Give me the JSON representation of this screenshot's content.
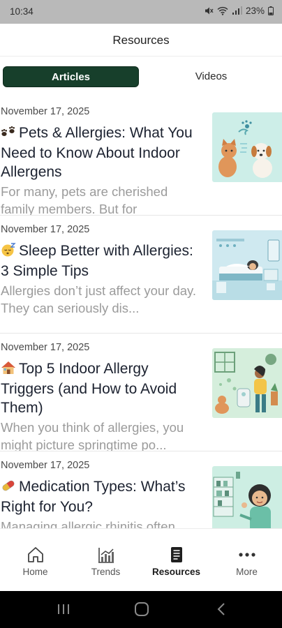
{
  "status_bar": {
    "time": "10:34",
    "battery": "23%"
  },
  "header": {
    "title": "Resources"
  },
  "tabs": {
    "articles": "Articles",
    "videos": "Videos"
  },
  "articles": [
    {
      "date": "November 17, 2025",
      "title": "Pets & Allergies: What You Need to Know About Indoor Allergens",
      "excerpt": "For many, pets are cherished family members. But for",
      "emoji": "paw-prints-icon",
      "thumbnail": "pets-illustration"
    },
    {
      "date": "November 17, 2025",
      "title": "Sleep Better with Allergies: 3 Simple Tips",
      "excerpt": "Allergies don’t just affect your day. They can seriously dis...",
      "emoji": "sleeping-face-icon",
      "thumbnail": "bedroom-illustration"
    },
    {
      "date": "November 17, 2025",
      "title": "Top 5 Indoor Allergy Triggers (and How to Avoid Them)",
      "excerpt": "When you think of allergies, you might picture springtime po...",
      "emoji": "house-icon",
      "thumbnail": "indoor-woman-illustration"
    },
    {
      "date": "November 17, 2025",
      "title": "Medication Types: What’s Right for You?",
      "excerpt": "Managing allergic rhinitis often",
      "emoji": "pill-icon",
      "thumbnail": "pharmacy-illustration"
    }
  ],
  "bottom_nav": {
    "items": [
      {
        "label": "Home",
        "icon": "home-icon"
      },
      {
        "label": "Trends",
        "icon": "trends-chart-icon"
      },
      {
        "label": "Resources",
        "icon": "resources-document-icon"
      },
      {
        "label": "More",
        "icon": "more-dots-icon"
      }
    ],
    "active": "Resources"
  },
  "colors": {
    "accent": "#173f2b",
    "thumb_bg": "#cdeee8",
    "title": "#1c2230",
    "excerpt": "#9b9b9b"
  }
}
